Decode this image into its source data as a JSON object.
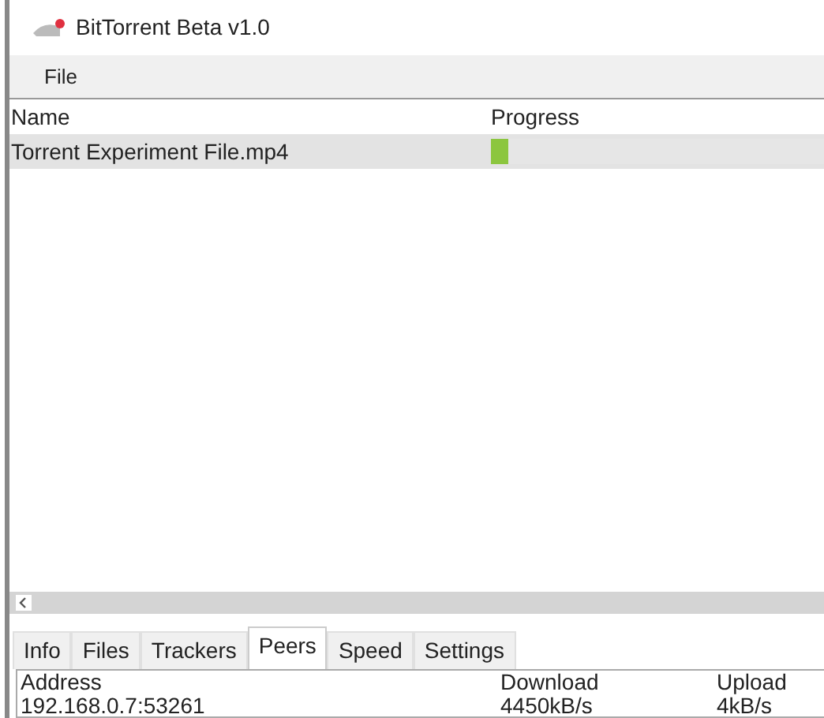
{
  "window": {
    "title": "BitTorrent Beta v1.0"
  },
  "menu": [
    "File"
  ],
  "table": {
    "columns": [
      "Name",
      "Progress"
    ],
    "rows": [
      {
        "name": "Torrent Experiment File.mp4",
        "level": 0.05,
        "selected": true
      }
    ]
  },
  "tabs": [
    {
      "label": "Info",
      "selected": false
    },
    {
      "label": "Files",
      "selected": false
    },
    {
      "label": "Trackers",
      "selected": false
    },
    {
      "label": "Peers",
      "selected": true
    },
    {
      "label": "Speed",
      "selected": false
    },
    {
      "label": "Settings",
      "selected": false
    }
  ],
  "peers": {
    "columns": [
      "Address",
      "Download",
      "Upload"
    ],
    "rows": [
      [
        "192.168.0.7:53261",
        "4450kB/s",
        "4kB/s"
      ]
    ]
  }
}
